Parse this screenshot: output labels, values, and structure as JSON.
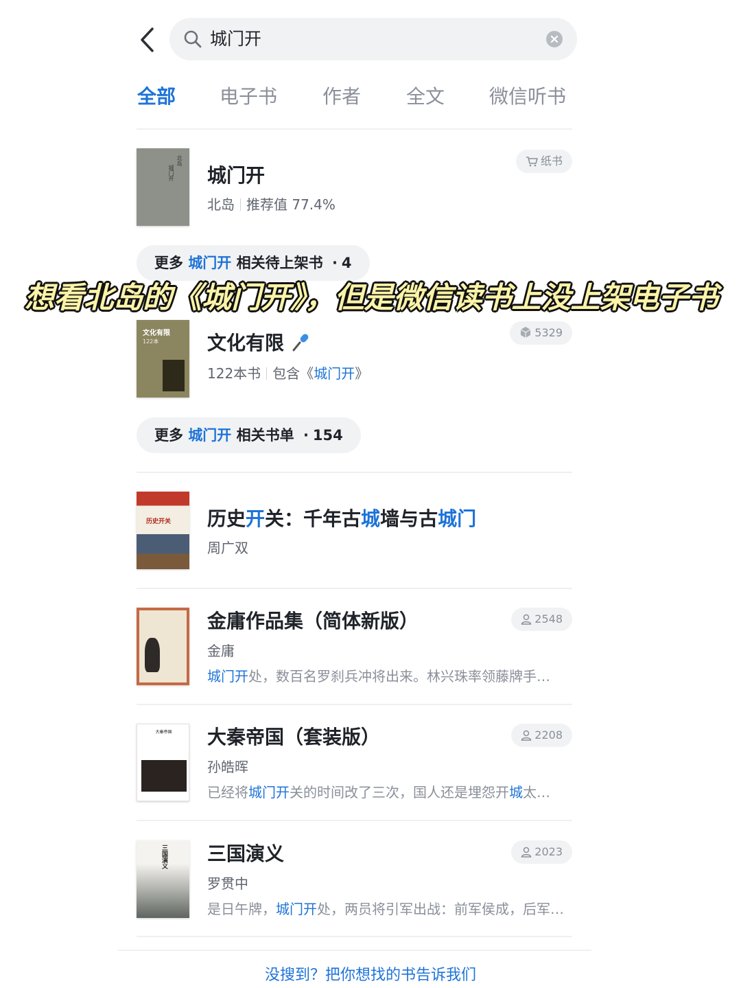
{
  "search": {
    "query": "城门开"
  },
  "tabs": [
    {
      "label": "全部",
      "active": true
    },
    {
      "label": "电子书",
      "active": false
    },
    {
      "label": "作者",
      "active": false
    },
    {
      "label": "全文",
      "active": false
    },
    {
      "label": "微信听书",
      "active": false
    }
  ],
  "top_result": {
    "cover_text": [
      "北岛",
      "城门开"
    ],
    "title": "城门开",
    "author": "北岛",
    "recommend": "推荐值 77.4%",
    "badge": "纸书"
  },
  "more_books": {
    "prefix": "更多",
    "keyword": "城门开",
    "suffix": "相关待上架书",
    "dot": "·",
    "count": "4"
  },
  "overlay_caption": "想看北岛的《城门开》，但是微信读书上没上架电子书",
  "booklist": {
    "cover_title": "文化有限",
    "cover_count": "122本",
    "title": "文化有限",
    "title_icon": "microphone-emoji",
    "count": "122本书",
    "contains_prefix": "包含《",
    "contains_keyword": "城门开",
    "contains_suffix": "》",
    "badge": "5329"
  },
  "more_lists": {
    "prefix": "更多",
    "keyword": "城门开",
    "suffix": "相关书单",
    "dot": "·",
    "count": "154"
  },
  "results": [
    {
      "title_parts": [
        {
          "text": "历史",
          "hl": false
        },
        {
          "text": "开",
          "hl": true
        },
        {
          "text": "关：千年古",
          "hl": false
        },
        {
          "text": "城",
          "hl": true
        },
        {
          "text": "墙与古",
          "hl": false
        },
        {
          "text": "城门",
          "hl": true
        }
      ],
      "author": "周广双",
      "cover_text": "历史开关"
    },
    {
      "title": "金庸作品集（简体新版）",
      "author": "金庸",
      "badge": "2548",
      "snippet_parts": [
        {
          "text": "城门开",
          "hl": true
        },
        {
          "text": "处，数百名罗刹兵冲将出来。林兴珠率领藤牌手…",
          "hl": false
        }
      ]
    },
    {
      "title": "大秦帝国（套装版）",
      "author": "孙皓晖",
      "badge": "2208",
      "cover_text": "大秦帝国",
      "snippet_parts": [
        {
          "text": "已经将",
          "hl": false
        },
        {
          "text": "城门开",
          "hl": true
        },
        {
          "text": "关的时间改了三次，国人还是埋怨开",
          "hl": false
        },
        {
          "text": "城",
          "hl": true
        },
        {
          "text": "太…",
          "hl": false
        }
      ]
    },
    {
      "title": "三国演义",
      "author": "罗贯中",
      "badge": "2023",
      "cover_text": "三国演义",
      "snippet_parts": [
        {
          "text": "是日午牌，",
          "hl": false
        },
        {
          "text": "城门开",
          "hl": true
        },
        {
          "text": "处，两员将引军出战：前军侯成，后军…",
          "hl": false
        }
      ]
    }
  ],
  "footer": "没搜到？把你想找的书告诉我们",
  "colors": {
    "accent": "#1d73d8",
    "text": "#1f2329",
    "muted": "#8a8f99",
    "chip_bg": "#f1f2f4",
    "overlay_text": "#fbf3a8"
  }
}
